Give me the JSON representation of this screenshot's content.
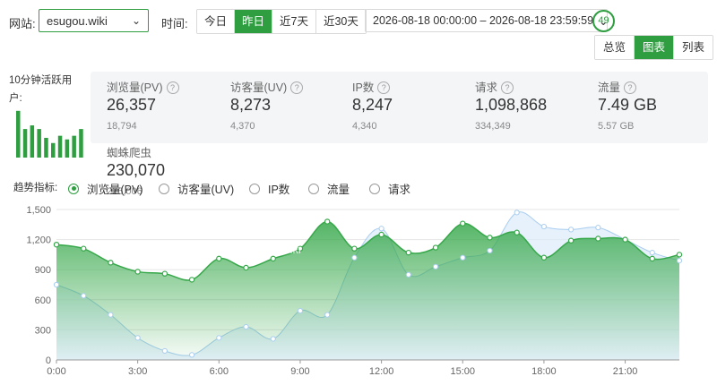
{
  "filters": {
    "site_label": "网站:",
    "site_value": "esugou.wiki",
    "time_label": "时间:",
    "time_buttons": [
      "今日",
      "昨日",
      "近7天",
      "近30天"
    ],
    "active_time": 1,
    "date_range": "2026-08-18 00:00:00 – 2026-08-18 23:59:59",
    "counter": "49"
  },
  "view_tabs": [
    "总览",
    "图表",
    "列表"
  ],
  "active_view": 1,
  "active_users": {
    "label": "10分钟活跃用户:",
    "bars": [
      0.9,
      0.55,
      0.62,
      0.55,
      0.38,
      0.28,
      0.42,
      0.35,
      0.42,
      0.55
    ]
  },
  "stats": [
    {
      "name": "浏览量(PV)",
      "value": "26,357",
      "sub": "18,794"
    },
    {
      "name": "访客量(UV)",
      "value": "8,273",
      "sub": "4,370"
    },
    {
      "name": "IP数",
      "value": "8,247",
      "sub": "4,340"
    },
    {
      "name": "请求",
      "value": "1,098,868",
      "sub": "334,349"
    },
    {
      "name": "流量",
      "value": "7.49 GB",
      "sub": "5.57 GB"
    }
  ],
  "spider": {
    "name": "蜘蛛爬虫",
    "value": "230,070",
    "sub": "226,006"
  },
  "trend": {
    "label": "趋势指标:",
    "options": [
      "浏览量(PV)",
      "访客量(UV)",
      "IP数",
      "流量",
      "请求"
    ],
    "selected": 0
  },
  "chart_data": {
    "type": "area",
    "watermark": "esugou.wiki",
    "ylim": [
      0,
      1500
    ],
    "y_ticks": [
      "0",
      "300",
      "600",
      "900",
      "1,200",
      "1,500"
    ],
    "x_ticks": [
      "0:00",
      "3:00",
      "6:00",
      "9:00",
      "12:00",
      "15:00",
      "18:00",
      "21:00"
    ],
    "x": [
      0,
      1,
      2,
      3,
      4,
      5,
      6,
      7,
      8,
      9,
      10,
      11,
      12,
      13,
      14,
      15,
      16,
      17,
      18,
      19,
      20,
      21,
      22,
      23
    ],
    "series": [
      {
        "values": [
          1150,
          1110,
          970,
          880,
          860,
          800,
          1010,
          920,
          1010,
          1110,
          1380,
          1110,
          1250,
          1070,
          1120,
          1360,
          1220,
          1270,
          1020,
          1190,
          1210,
          1200,
          1010,
          1050
        ]
      },
      {
        "values": [
          750,
          640,
          450,
          220,
          90,
          50,
          220,
          330,
          210,
          490,
          450,
          1020,
          1310,
          850,
          930,
          1020,
          1090,
          1470,
          1330,
          1300,
          1320,
          1200,
          1070,
          990
        ]
      }
    ],
    "colors": {
      "pv": "#36a84a",
      "uv": "#a9cdf0"
    }
  }
}
